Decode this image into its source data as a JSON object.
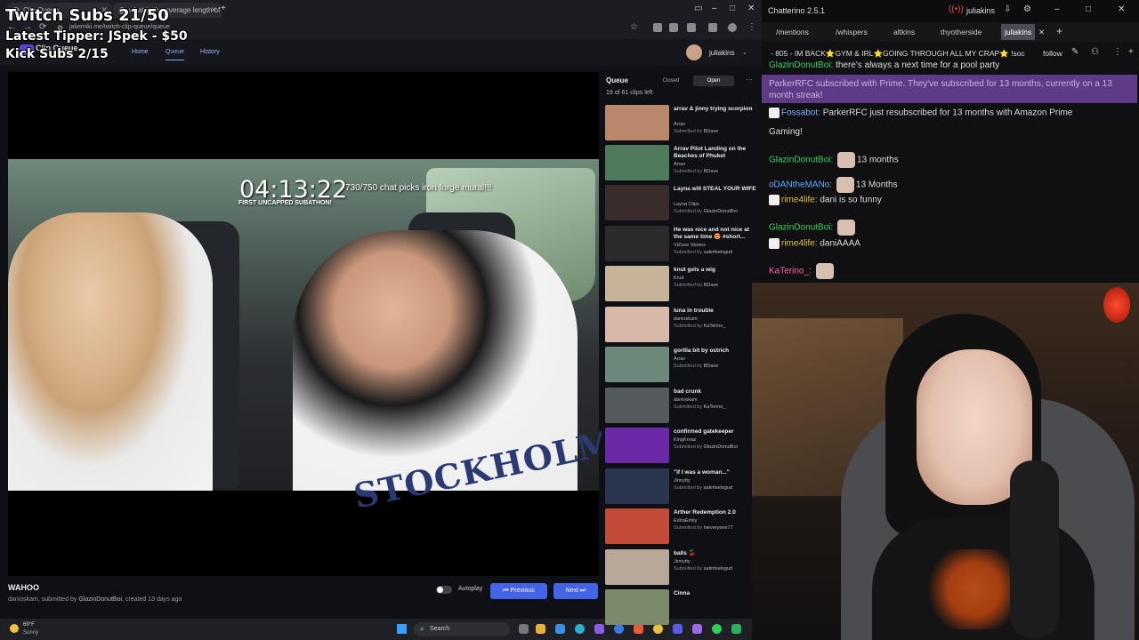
{
  "overlay": {
    "subs": "Twitch Subs 21/50",
    "tipper": "Latest Tipper: JSpek - $50",
    "kick": "Kick Subs 2/15"
  },
  "browser": {
    "tabs": [
      "Clip Queue",
      "what is the average length of a"
    ],
    "url": "jakemiki.me/twitch-clip-queue/queue"
  },
  "app": {
    "title": "Clip Queue",
    "nav": [
      "Home",
      "Queue",
      "History"
    ],
    "user": "juliakins"
  },
  "video": {
    "timer": "04:13:22",
    "goal": "730/750 chat picks iron forge mural!!!",
    "sub": "FIRST UNCAPPED SUBATHON!",
    "shirt_text": "STOCKHOLM"
  },
  "clip": {
    "title": "WAHOO",
    "author": "danioskam",
    "submitted_prefix": ", submitted by ",
    "submitter": "GlazinDonutBoi",
    "created": ", created 13 days ago",
    "autoplay_label": "Autoplay",
    "prev_label": "Previous",
    "next_label": "Next"
  },
  "queue": {
    "title": "Queue",
    "tab_closed": "Closed",
    "tab_open": "Open",
    "count": "19 of 61 clips left",
    "submitted_label": "Submitted by ",
    "items": [
      {
        "title": "arrav & jinny trying scorpion",
        "author": "Arrav",
        "submitter": "BDave",
        "color": "#b9876a"
      },
      {
        "title": "Arrav Pilot Landing on the Beaches of Phuket",
        "author": "Arrav",
        "submitter": "BDave",
        "color": "#4f7a5c"
      },
      {
        "title": "Layna will STEAL YOUR WIFE",
        "author": "Layna Clips",
        "submitter": "GlazinDonutBoi",
        "color": "#3a2c2a"
      },
      {
        "title": "He was nice and not nice at the same time 😍 #short...",
        "author": "ViZone Stories",
        "submitter": "satinfeelsgud",
        "color": "#2c2a2a"
      },
      {
        "title": "knut gets a wig",
        "author": "Knut",
        "submitter": "BDave",
        "color": "#c7b39a"
      },
      {
        "title": "luna in trouble",
        "author": "danioskam",
        "submitter": "KaTerino_",
        "color": "#d8b8a8"
      },
      {
        "title": "gorilla bit by ostrich",
        "author": "Arrav",
        "submitter": "BDave",
        "color": "#6c8a7c"
      },
      {
        "title": "bad crunk",
        "author": "danioskam",
        "submitter": "KaTerino_",
        "color": "#555a5e"
      },
      {
        "title": "confirmed gatekeeper",
        "author": "KingKreaz",
        "submitter": "GlazinDonutBoi",
        "color": "#6a2aa8"
      },
      {
        "title": "\"if I was a woman...\"",
        "author": "Jinnytty",
        "submitter": "satinfeelsgud",
        "color": "#2a3550"
      },
      {
        "title": "Arther Redemption 2.0",
        "author": "ExtraEmily",
        "submitter": "hieveryone77",
        "color": "#c44a3a"
      },
      {
        "title": "balls 🍒",
        "author": "Jinnytty",
        "submitter": "satinfeelsgud",
        "color": "#b8a89a"
      },
      {
        "title": "Cinna",
        "author": "",
        "submitter": "",
        "color": "#7a8a6a"
      }
    ]
  },
  "taskbar": {
    "temp": "69°F",
    "weather": "Sunny",
    "search": "Search"
  },
  "chat": {
    "app_title": "Chatterino 2.5.1",
    "user": "juliakins",
    "splits": [
      "/mentions",
      "/whispers",
      "altkins",
      "thyotherside",
      "juliakins"
    ],
    "channel_title": "- 805 - IM BACK⭐GYM & IRL⭐GOING THROUGH ALL MY CRAP⭐ !soc",
    "follow": "follow",
    "messages": [
      {
        "name": "GlazinDonutBoi",
        "color": "#33d05a",
        "text": "there's always a next time for a pool party"
      },
      {
        "name": "Fossabot",
        "color": "#7fb0ff",
        "text": "ParkerRFC just resubscribed for 13 months with Amazon Prime"
      },
      {
        "name": "",
        "color": "#ddd",
        "text": "Gaming!"
      },
      {
        "name": "GlazinDonutBoi",
        "color": "#33d05a",
        "text": "13 months"
      },
      {
        "name": "oDANtheMANo",
        "color": "#66aaff",
        "text": "13 Months"
      },
      {
        "name": "rime4life",
        "color": "#e0c040",
        "text": "dani is so funny"
      },
      {
        "name": "GlazinDonutBoi",
        "color": "#33d05a",
        "text": ""
      },
      {
        "name": "rime4life",
        "color": "#e0c040",
        "text": "daniAAAA"
      },
      {
        "name": "KaTerino_",
        "color": "#ff66aa",
        "text": ""
      }
    ],
    "sub_notice": "ParkerRFC subscribed with Prime. They've subscribed for 13 months, currently on a 13 month streak!"
  }
}
